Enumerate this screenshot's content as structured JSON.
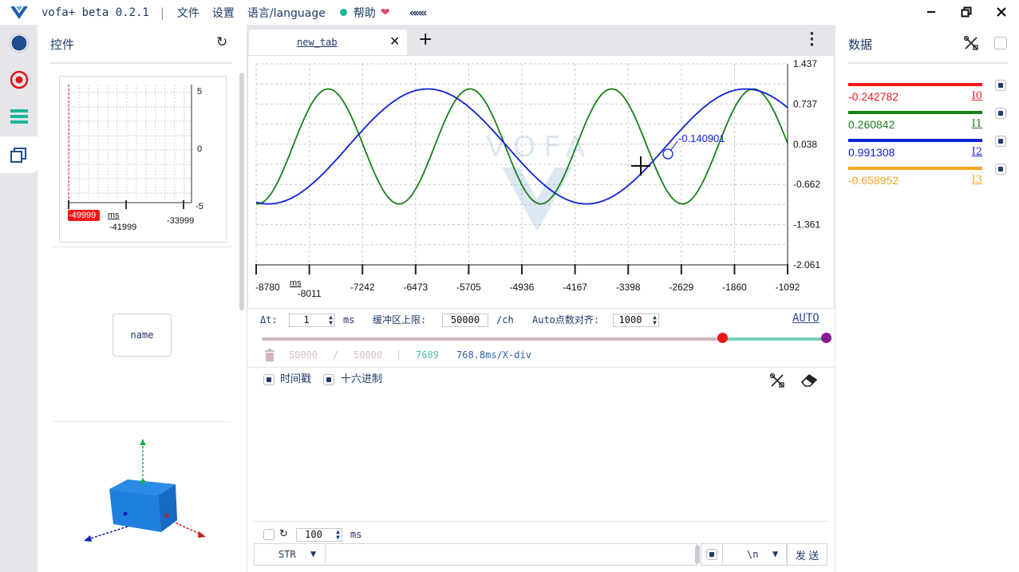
{
  "titlebar": {
    "app_name": "vofa+ beta 0.2.1",
    "menu": [
      "文件",
      "设置",
      "语言/language",
      "帮助"
    ],
    "collapse_label": "«««"
  },
  "controls_panel": {
    "title": "控件",
    "mini_chart": {
      "y_ticks": [
        "5",
        "0",
        "-5"
      ],
      "x_ticks": [
        "-49999",
        "-41999",
        "-33999"
      ],
      "x_unit": "ms"
    },
    "name_button": "name"
  },
  "tabs": [
    {
      "label": "new_tab"
    }
  ],
  "chart_data": {
    "type": "line",
    "x_ticks": [
      "-8780",
      "-8011",
      "-7242",
      "-6473",
      "-5705",
      "-4936",
      "-4167",
      "-3398",
      "-2629",
      "-1860",
      "-1092"
    ],
    "x_unit": "ms",
    "y_ticks": [
      "1.437",
      "0.737",
      "0.038",
      "-0.662",
      "-1.361",
      "-2.061"
    ],
    "xlim": [
      -8780,
      -1092
    ],
    "ylim": [
      -2.061,
      1.437
    ],
    "grid": true,
    "cursor_label": "-0.140901",
    "series": [
      {
        "color": "#1a7f1a",
        "amplitude": 1.0,
        "period_ms": 2050,
        "phase_ms": -8250
      },
      {
        "color": "#0f20d8",
        "amplitude": 1.0,
        "period_ms": 4600,
        "phase_ms": -7450
      }
    ]
  },
  "settings": {
    "dt_label": "Δt:",
    "dt_value": "1",
    "dt_unit": "ms",
    "buffer_label": "缓冲区上限:",
    "buffer_value": "50000",
    "buffer_unit": "/ch",
    "align_label": "Auto点数对齐:",
    "align_value": "1000",
    "auto_label": "AUTO"
  },
  "stats": {
    "count_a": "50000",
    "slash": "/",
    "count_b": "50000",
    "pipe": "|",
    "points": "7689",
    "div": "768.8ms/X-div"
  },
  "console": {
    "timestamp_label": "时间戳",
    "hex_label": "十六进制"
  },
  "send": {
    "interval_value": "100",
    "interval_unit": "ms",
    "format_value": "STR",
    "newline_value": "\\n",
    "send_label": "发 送"
  },
  "data_panel": {
    "title": "数据",
    "channels": [
      {
        "value": "-0.242782",
        "name": "I0",
        "color": "#f01818"
      },
      {
        "value": "0.260842",
        "name": "I1",
        "color": "#1a7f1a"
      },
      {
        "value": "0.991308",
        "name": "I2",
        "color": "#0f20d8"
      },
      {
        "value": "-0.658952",
        "name": "I3",
        "color": "#f5a623"
      }
    ]
  }
}
